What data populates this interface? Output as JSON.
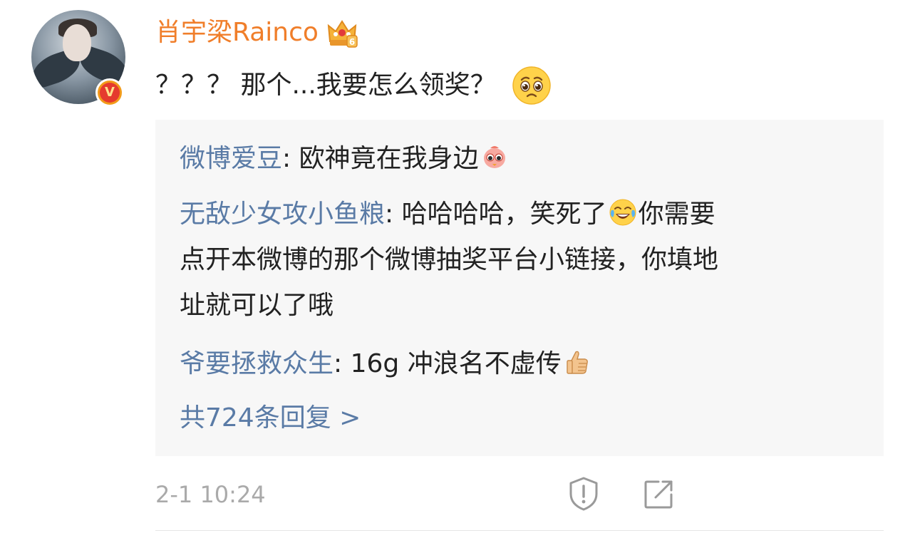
{
  "comment": {
    "username": "肖宇梁Rainco",
    "text": "？？？ 那个...我要怎么领奖？",
    "timestamp": "2-1 10:24"
  },
  "replies": [
    {
      "nick": "微博爱豆",
      "text": ": 欧神竟在我身边"
    },
    {
      "nick": "无敌少女攻小鱼粮",
      "text_part1": ": 哈哈哈哈，笑死了",
      "text_part2": "你需要",
      "line2": "点开本微博的那个微博抽奖平台小链接，你填地",
      "line3": "址就可以了哦"
    },
    {
      "nick": "爷要拯救众生",
      "text": ": 16g 冲浪名不虚传"
    }
  ],
  "more_replies": "共724条回复 >",
  "colors": {
    "username": "#f07e2a",
    "nick": "#5a7ba6",
    "reply_bg": "#f7f7f7",
    "timestamp": "#aaaaaa"
  },
  "icons": {
    "badge": "crown-level-6-icon",
    "verified": "verified-v-icon",
    "report": "report-shield-icon",
    "share": "share-edit-icon"
  }
}
